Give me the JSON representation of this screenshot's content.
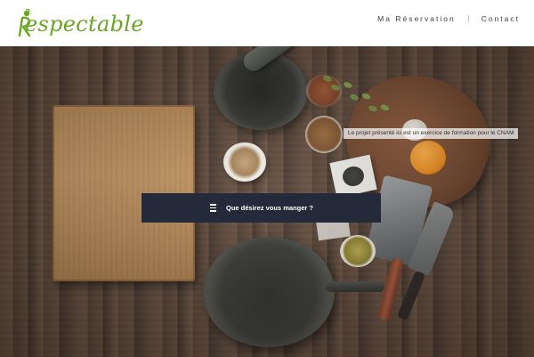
{
  "brand": {
    "logo_text_part1": "espec",
    "logo_text_part2": "table",
    "logo_initial": "R",
    "logo_color": "#6aa524"
  },
  "nav": {
    "items": [
      {
        "label": "Ma Réservation"
      },
      {
        "label": "Contact"
      }
    ],
    "text_color": "#3c3c3c"
  },
  "hero": {
    "caption": "Le projet présenté ici est un exercice de formation pour le CNAM",
    "search": {
      "label": "Que désirez vous manger ?",
      "icon": "menu-icon",
      "background_color": "#252a3a"
    }
  }
}
